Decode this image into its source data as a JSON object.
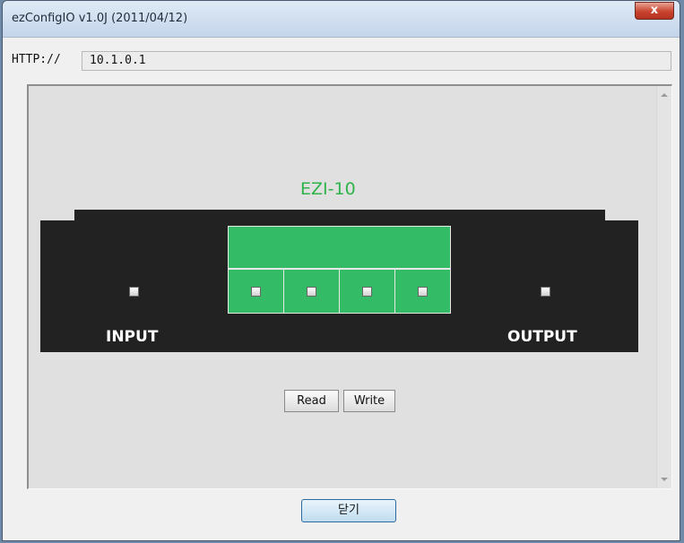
{
  "window": {
    "title": "ezConfigIO v1.0J (2011/04/12)",
    "close_glyph": "x"
  },
  "address": {
    "prefix": "HTTP://",
    "value": "10.1.0.1"
  },
  "device": {
    "model": "EZI-10",
    "input_label": "INPUT",
    "output_label": "OUTPUT",
    "bits_count": 4,
    "colors": {
      "board": "#222222",
      "panel": "#34bb66",
      "model_text": "#2eb34a"
    }
  },
  "actions": {
    "read": "Read",
    "write": "Write"
  },
  "footer": {
    "close": "닫기"
  }
}
